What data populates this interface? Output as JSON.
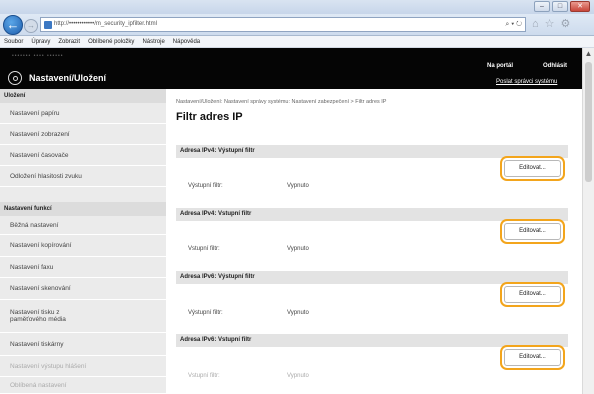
{
  "browser": {
    "address": "http://••••••••••••/m_security_ipfilter.html",
    "address_tools": "⌕ ▾ ↻",
    "back": "←",
    "forward": "→",
    "menu": [
      "Soubor",
      "Úpravy",
      "Zobrazit",
      "Oblíbené položky",
      "Nástroje",
      "Nápověda"
    ],
    "window_controls": [
      "–",
      "□",
      "✕"
    ]
  },
  "header": {
    "logo_text": "•••••••  ••••  ••••••",
    "title": "Nastavení/Uložení",
    "portal_link": "Na portál",
    "logout_link": "Odhlásit",
    "mail_link": "Poslat správci systému"
  },
  "sidebar": {
    "group1": "Uložení",
    "items1": [
      "Nastavení papíru",
      "Nastavení zobrazení",
      "Nastavení časovače",
      "Odložení hlasitosti zvuku"
    ],
    "group2": "Nastavení funkcí",
    "items2": [
      "Běžná nastavení",
      "Nastavení kopírování",
      "Nastavení faxu",
      "Nastavení skenování",
      "Nastavení tisku z paměťového média",
      "Nastavení tiskárny",
      "Nastavení výstupu hlášení",
      "Oblíbená nastavení"
    ]
  },
  "main": {
    "breadcrumb": "Nastavení/Uložení: Nastavení správy systému: Nastavení zabezpečení > Filtr adres IP",
    "title": "Filtr adres IP",
    "edit_label": "Editovat...",
    "sections": [
      {
        "header": "Adresa IPv4: Výstupní filtr",
        "label": "Výstupní filtr:",
        "value": "Vypnuto"
      },
      {
        "header": "Adresa IPv4: Vstupní filtr",
        "label": "Vstupní filtr:",
        "value": "Vypnuto"
      },
      {
        "header": "Adresa IPv6: Výstupní filtr",
        "label": "Výstupní filtr:",
        "value": "Vypnuto"
      },
      {
        "header": "Adresa IPv6: Vstupní filtr",
        "label": "Vstupní filtr:",
        "value": "Vypnuto"
      }
    ]
  },
  "colors": {
    "highlight_ring": "#f3a51c",
    "header_bg": "#050505",
    "sidebar_bg": "#ebebeb"
  },
  "icons": {
    "header_icon": "settings-gear-icon",
    "back": "back-arrow-icon",
    "forward": "forward-arrow-icon",
    "home": "home-icon",
    "favorites": "star-icon",
    "tools": "gear-icon"
  }
}
